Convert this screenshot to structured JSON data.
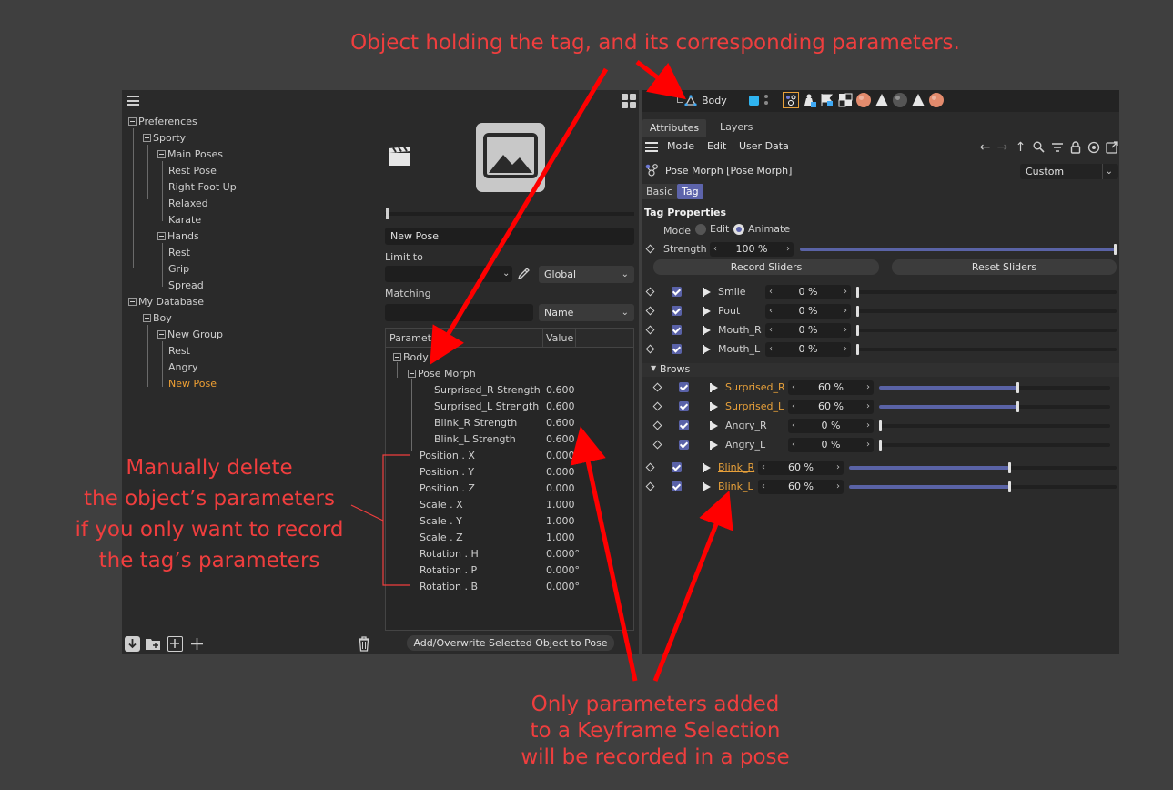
{
  "annotations": {
    "top": "Object holding the tag, and its corresponding parameters.",
    "left": [
      "Manually delete",
      "the object’s parameters",
      "if you only want to record",
      "the tag’s parameters"
    ],
    "bottom": [
      "Only parameters added",
      "to a Keyframe Selection",
      "will be recorded in a pose"
    ]
  },
  "pose_library": {
    "tree": [
      {
        "label": "Preferences",
        "level": 0,
        "expanded": true
      },
      {
        "label": "Sporty",
        "level": 1,
        "expanded": true
      },
      {
        "label": "Main Poses",
        "level": 2,
        "expanded": true
      },
      {
        "label": "Rest Pose",
        "level": 3
      },
      {
        "label": "Right Foot Up",
        "level": 3
      },
      {
        "label": "Relaxed",
        "level": 3
      },
      {
        "label": "Karate",
        "level": 3
      },
      {
        "label": "Hands",
        "level": 2,
        "expanded": true
      },
      {
        "label": "Rest",
        "level": 3
      },
      {
        "label": "Grip",
        "level": 3
      },
      {
        "label": "Spread",
        "level": 3
      },
      {
        "label": "My Database",
        "level": 0,
        "expanded": true
      },
      {
        "label": "Boy",
        "level": 1,
        "expanded": true
      },
      {
        "label": "New Group",
        "level": 2,
        "expanded": true
      },
      {
        "label": "Rest",
        "level": 3
      },
      {
        "label": "Angry",
        "level": 3
      },
      {
        "label": "New Pose",
        "level": 3,
        "selected": true
      }
    ],
    "pose_name": "New Pose",
    "limit_to_label": "Limit to",
    "limit_to_value": "",
    "space_dropdown": "Global",
    "matching_label": "Matching",
    "matching_value": "",
    "matching_dropdown": "Name",
    "table_headers": {
      "parameter": "Parameter",
      "value": "Value"
    },
    "table_root": "Body",
    "table_tag": "Pose Morph",
    "table_rows": [
      {
        "name": "Surprised_R Strength",
        "value": "0.600",
        "tagparam": true
      },
      {
        "name": "Surprised_L Strength",
        "value": "0.600",
        "tagparam": true
      },
      {
        "name": "Blink_R Strength",
        "value": "0.600",
        "tagparam": true
      },
      {
        "name": "Blink_L Strength",
        "value": "0.600",
        "tagparam": true
      },
      {
        "name": "Position . X",
        "value": "0.000"
      },
      {
        "name": "Position . Y",
        "value": "0.000"
      },
      {
        "name": "Position . Z",
        "value": "0.000"
      },
      {
        "name": "Scale . X",
        "value": "1.000"
      },
      {
        "name": "Scale . Y",
        "value": "1.000"
      },
      {
        "name": "Scale . Z",
        "value": "1.000"
      },
      {
        "name": "Rotation . H",
        "value": "0.000°"
      },
      {
        "name": "Rotation . P",
        "value": "0.000°"
      },
      {
        "name": "Rotation . B",
        "value": "0.000°"
      }
    ],
    "add_button": "Add/Overwrite Selected Object to Pose"
  },
  "attributes": {
    "object_name": "Body",
    "tabs": [
      "Attributes",
      "Layers"
    ],
    "menu": [
      "Mode",
      "Edit",
      "User Data"
    ],
    "tag_title": "Pose Morph [Pose Morph]",
    "layout_dropdown": "Custom",
    "subtabs": [
      "Basic",
      "Tag"
    ],
    "section": "Tag Properties",
    "mode_label": "Mode",
    "mode_options": [
      "Edit",
      "Animate"
    ],
    "mode_selected": "Animate",
    "strength_label": "Strength",
    "strength_value": "100 %",
    "strength_fraction": 1.0,
    "record_button": "Record Sliders",
    "reset_button": "Reset Sliders",
    "group_label": "Brows",
    "sliders_top": [
      {
        "name": "Smile",
        "value": "0 %",
        "fraction": 0
      },
      {
        "name": "Pout",
        "value": "0 %",
        "fraction": 0
      },
      {
        "name": "Mouth_R",
        "value": "0 %",
        "fraction": 0
      },
      {
        "name": "Mouth_L",
        "value": "0 %",
        "fraction": 0
      }
    ],
    "sliders_brows": [
      {
        "name": "Surprised_R",
        "value": "60 %",
        "fraction": 0.6,
        "keyed": true
      },
      {
        "name": "Surprised_L",
        "value": "60 %",
        "fraction": 0.6,
        "keyed": true
      },
      {
        "name": "Angry_R",
        "value": "0 %",
        "fraction": 0
      },
      {
        "name": "Angry_L",
        "value": "0 %",
        "fraction": 0
      }
    ],
    "sliders_bottom": [
      {
        "name": "Blink_R",
        "value": "60 %",
        "fraction": 0.6,
        "keyed": true
      },
      {
        "name": "Blink_L",
        "value": "60 %",
        "fraction": 0.6,
        "keyed": true
      }
    ]
  },
  "colors": {
    "accent": "#5d64ab",
    "keyed": "#e7a03a",
    "annotation": "#ef3e3e",
    "selected_item": "#f0a033"
  }
}
